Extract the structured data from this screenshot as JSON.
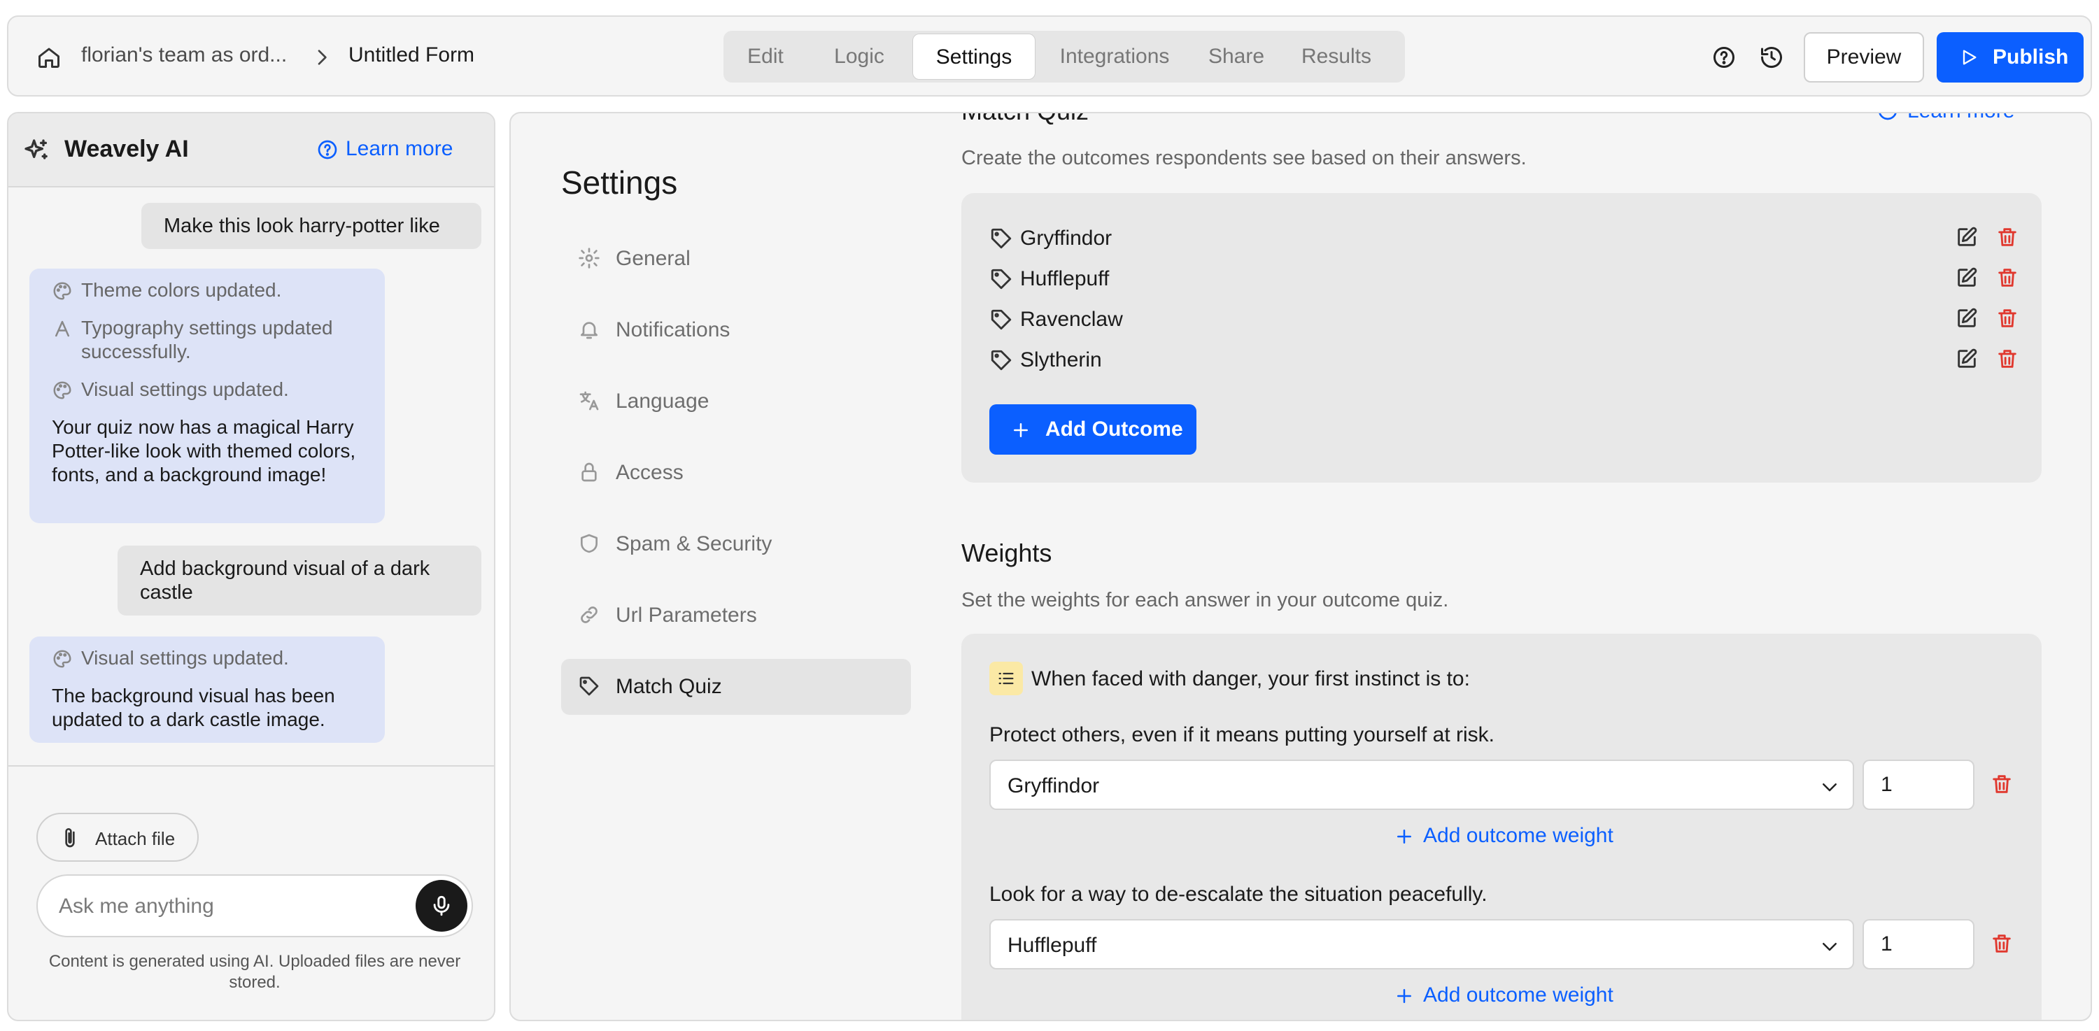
{
  "topbar": {
    "team": "florian's team as ord...",
    "form_title": "Untitled Form",
    "tabs": [
      "Edit",
      "Logic",
      "Settings",
      "Integrations",
      "Share",
      "Results"
    ],
    "active_tab": "Settings",
    "preview_label": "Preview",
    "publish_label": "Publish"
  },
  "ai_panel": {
    "title": "Weavely AI",
    "learn_more": "Learn more",
    "messages": [
      {
        "role": "user",
        "text": "Make this look harry-potter like"
      },
      {
        "role": "ai",
        "statuses": [
          "Theme colors updated.",
          "Typography settings updated successfully.",
          "Visual settings updated."
        ],
        "text": "Your quiz now has a magical Harry Potter-like look with themed colors, fonts, and a background image!"
      },
      {
        "role": "user",
        "text": "Add background visual of a dark castle"
      },
      {
        "role": "ai",
        "statuses": [
          "Visual settings updated."
        ],
        "text": "The background visual has been updated to a dark castle image."
      }
    ],
    "attach_label": "Attach file",
    "input_placeholder": "Ask me anything",
    "disclaimer": "Content is generated using AI. Uploaded files are never stored."
  },
  "settings": {
    "title": "Settings",
    "nav": [
      "General",
      "Notifications",
      "Language",
      "Access",
      "Spam & Security",
      "Url Parameters",
      "Match Quiz"
    ],
    "active_nav": "Match Quiz"
  },
  "match_quiz": {
    "title": "Match Quiz",
    "learn_more": "Learn more",
    "description": "Create the outcomes respondents see based on their answers.",
    "outcomes": [
      "Gryffindor",
      "Hufflepuff",
      "Ravenclaw",
      "Slytherin"
    ],
    "add_outcome_label": "Add Outcome"
  },
  "weights": {
    "title": "Weights",
    "description": "Set the weights for each answer in your outcome quiz.",
    "question": "When faced with danger, your first instinct is to:",
    "answers": [
      {
        "text": "Protect others, even if it means putting yourself at risk.",
        "outcome": "Gryffindor",
        "weight": "1"
      },
      {
        "text": "Look for a way to de-escalate the situation peacefully.",
        "outcome": "Hufflepuff",
        "weight": "1"
      }
    ],
    "add_weight_label": "Add outcome weight"
  },
  "colors": {
    "accent": "#0b5fff",
    "danger": "#e0382e",
    "ai_bubble": "#dde3f7"
  }
}
